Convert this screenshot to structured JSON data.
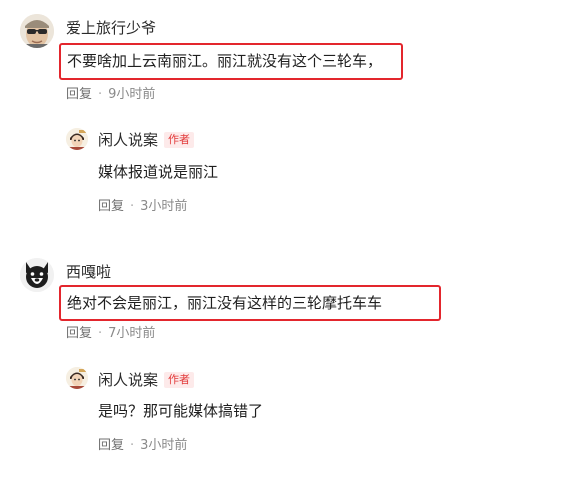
{
  "comments": [
    {
      "username": "爱上旅行少爷",
      "text": "不要啥加上云南丽江。丽江就没有这个三轮车，",
      "reply_label": "回复",
      "separator": "·",
      "time": "9小时前",
      "reply": {
        "username": "闲人说案",
        "author_tag": "作者",
        "text": "媒体报道说是丽江",
        "reply_label": "回复",
        "separator": "·",
        "time": "3小时前"
      }
    },
    {
      "username": "西嘎啦",
      "text": "绝对不会是丽江，丽江没有这样的三轮摩托车车",
      "reply_label": "回复",
      "separator": "·",
      "time": "7小时前",
      "reply": {
        "username": "闲人说案",
        "author_tag": "作者",
        "text": "是吗？那可能媒体搞错了",
        "reply_label": "回复",
        "separator": "·",
        "time": "3小时前"
      }
    }
  ],
  "colors": {
    "highlight_border": "#e3262d",
    "author_tag": "#e23b3b",
    "meta_text": "#8a8a8a"
  },
  "icons": {
    "avatar_1": "user-avatar-sunglasses",
    "avatar_2": "user-avatar-dog",
    "author_avatar": "author-avatar-cartoon"
  }
}
